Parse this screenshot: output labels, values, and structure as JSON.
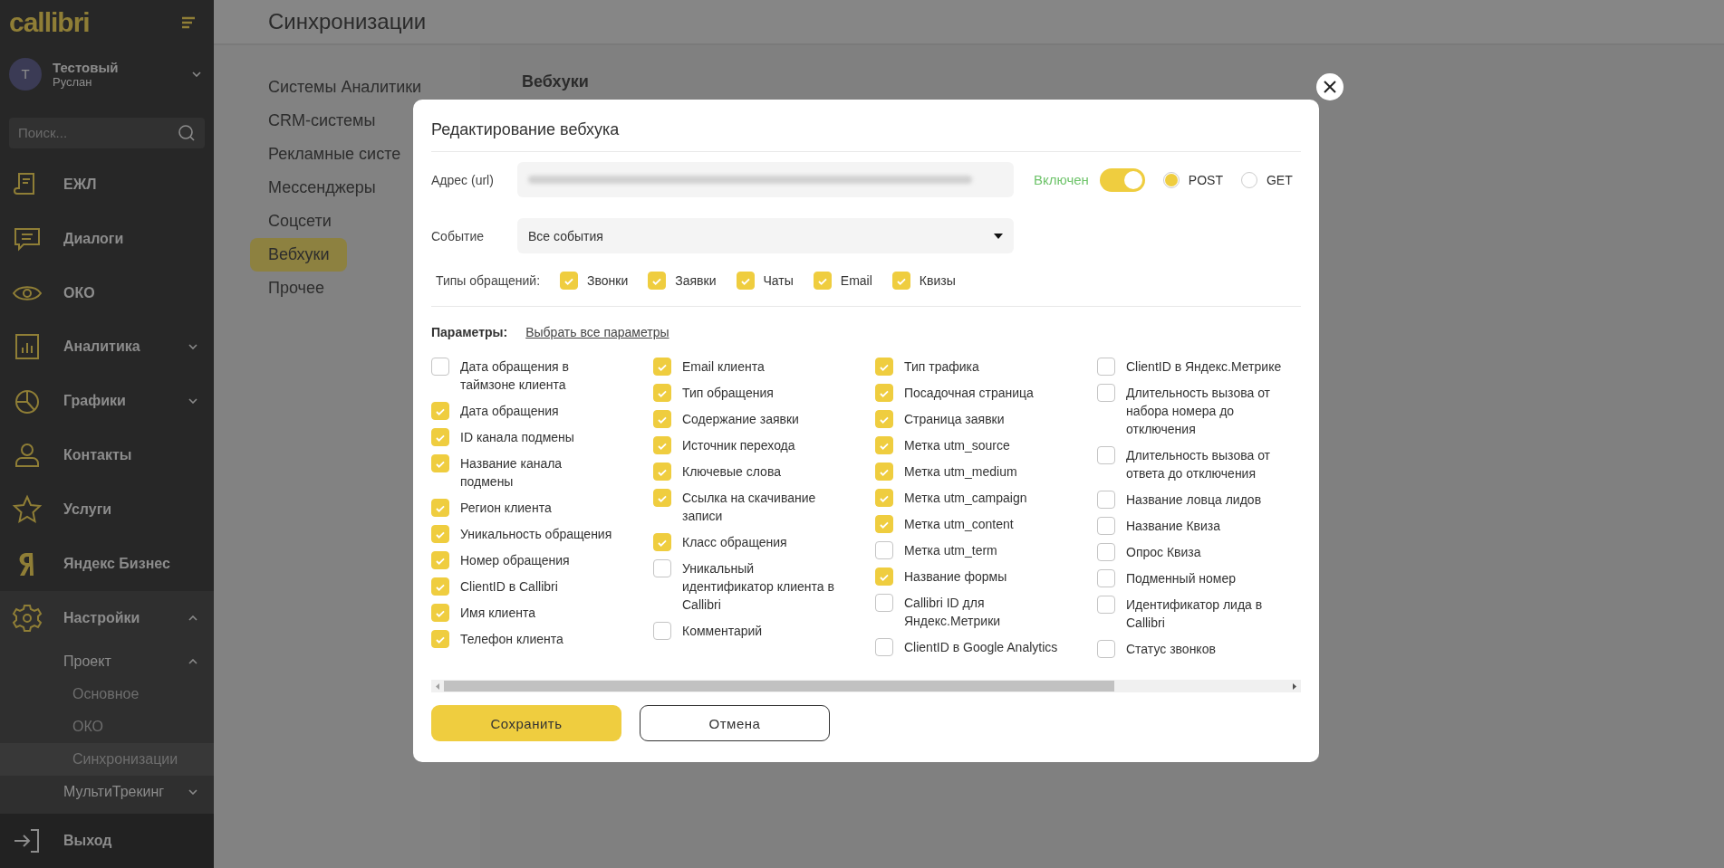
{
  "sidebar": {
    "logo": "callibri",
    "user": {
      "initial": "Т",
      "name": "Тестовый",
      "subtitle": "Руслан"
    },
    "search": {
      "placeholder": "Поиск..."
    },
    "items": [
      {
        "label": "ЕЖЛ"
      },
      {
        "label": "Диалоги"
      },
      {
        "label": "ОКО"
      },
      {
        "label": "Аналитика",
        "expanded": false
      },
      {
        "label": "Графики",
        "expanded": false
      },
      {
        "label": "Контакты"
      },
      {
        "label": "Услуги"
      },
      {
        "label": "Яндекс Бизнес"
      },
      {
        "label": "Настройки",
        "expanded": true,
        "children": [
          {
            "label": "Проект",
            "expanded": true,
            "children": [
              {
                "label": "Основное",
                "selected": false
              },
              {
                "label": "ОКО",
                "selected": false
              },
              {
                "label": "Синхронизации",
                "selected": true
              }
            ]
          },
          {
            "label": "МультиТрекинг",
            "expanded": false
          }
        ]
      }
    ],
    "logout": "Выход"
  },
  "page": {
    "title": "Синхронизации",
    "subnav": [
      {
        "label": "Системы Аналитики",
        "selected": false
      },
      {
        "label": "CRM-системы",
        "selected": false
      },
      {
        "label": "Рекламные систе",
        "selected": false
      },
      {
        "label": "Мессенджеры",
        "selected": false
      },
      {
        "label": "Соцсети",
        "selected": false
      },
      {
        "label": "Вебхуки",
        "selected": true
      },
      {
        "label": "Прочее",
        "selected": false
      }
    ],
    "panel_title": "Вебхуки"
  },
  "modal": {
    "title": "Редактирование вебхука",
    "url": {
      "label": "Адрес (url)"
    },
    "enabled": {
      "label": "Включен",
      "on": true
    },
    "methods": [
      {
        "label": "POST",
        "selected": true
      },
      {
        "label": "GET",
        "selected": false
      }
    ],
    "event": {
      "label": "Событие",
      "value": "Все события"
    },
    "types": {
      "label": "Типы обращений:",
      "options": [
        {
          "label": "Звонки",
          "checked": true
        },
        {
          "label": "Заявки",
          "checked": true
        },
        {
          "label": "Чаты",
          "checked": true
        },
        {
          "label": "Email",
          "checked": true
        },
        {
          "label": "Квизы",
          "checked": true
        }
      ]
    },
    "params": {
      "label": "Параметры:",
      "link": "Выбрать все параметры",
      "columns": [
        [
          {
            "label": "Дата обращения в таймзоне клиента",
            "checked": false
          },
          {
            "label": "Дата обращения",
            "checked": true
          },
          {
            "label": "ID канала подмены",
            "checked": true
          },
          {
            "label": "Название канала подмены",
            "checked": true
          },
          {
            "label": "Регион клиента",
            "checked": true
          },
          {
            "label": "Уникальность обращения",
            "checked": true
          },
          {
            "label": "Номер обращения",
            "checked": true
          },
          {
            "label": "ClientID в Callibri",
            "checked": true
          },
          {
            "label": "Имя клиента",
            "checked": true
          },
          {
            "label": "Телефон клиента",
            "checked": true
          }
        ],
        [
          {
            "label": "Email клиента",
            "checked": true
          },
          {
            "label": "Тип обращения",
            "checked": true
          },
          {
            "label": "Содержание заявки",
            "checked": true
          },
          {
            "label": "Источник перехода",
            "checked": true
          },
          {
            "label": "Ключевые слова",
            "checked": true
          },
          {
            "label": "Ссылка на скачивание записи",
            "checked": true
          },
          {
            "label": "Класс обращения",
            "checked": true
          },
          {
            "label": "Уникальный идентификатор клиента в Callibri",
            "checked": false
          },
          {
            "label": "Комментарий",
            "checked": false
          }
        ],
        [
          {
            "label": "Тип трафика",
            "checked": true
          },
          {
            "label": "Посадочная страница",
            "checked": true
          },
          {
            "label": "Страница заявки",
            "checked": true
          },
          {
            "label": "Метка utm_source",
            "checked": true
          },
          {
            "label": "Метка utm_medium",
            "checked": true
          },
          {
            "label": "Метка utm_campaign",
            "checked": true
          },
          {
            "label": "Метка utm_content",
            "checked": true
          },
          {
            "label": "Метка utm_term",
            "checked": false
          },
          {
            "label": "Название формы",
            "checked": true
          },
          {
            "label": "Callibri ID для Яндекс.Метрики",
            "checked": false
          },
          {
            "label": "ClientID в Google Analytics",
            "checked": false
          }
        ],
        [
          {
            "label": "ClientID в Яндекс.Метрике",
            "checked": false
          },
          {
            "label": "Длительность вызова от набора номера до отключения",
            "checked": false
          },
          {
            "label": "Длительность вызова от ответа до отключения",
            "checked": false
          },
          {
            "label": "Название ловца лидов",
            "checked": false
          },
          {
            "label": "Название Квиза",
            "checked": false
          },
          {
            "label": "Опрос Квиза",
            "checked": false
          },
          {
            "label": "Подменный номер",
            "checked": false
          },
          {
            "label": "Идентификатор лида в Callibri",
            "checked": false
          },
          {
            "label": "Статус звонков",
            "checked": false
          }
        ]
      ]
    },
    "buttons": [
      {
        "label": "Сохранить",
        "kind": "primary"
      },
      {
        "label": "Отмена",
        "kind": "secondary"
      }
    ]
  }
}
